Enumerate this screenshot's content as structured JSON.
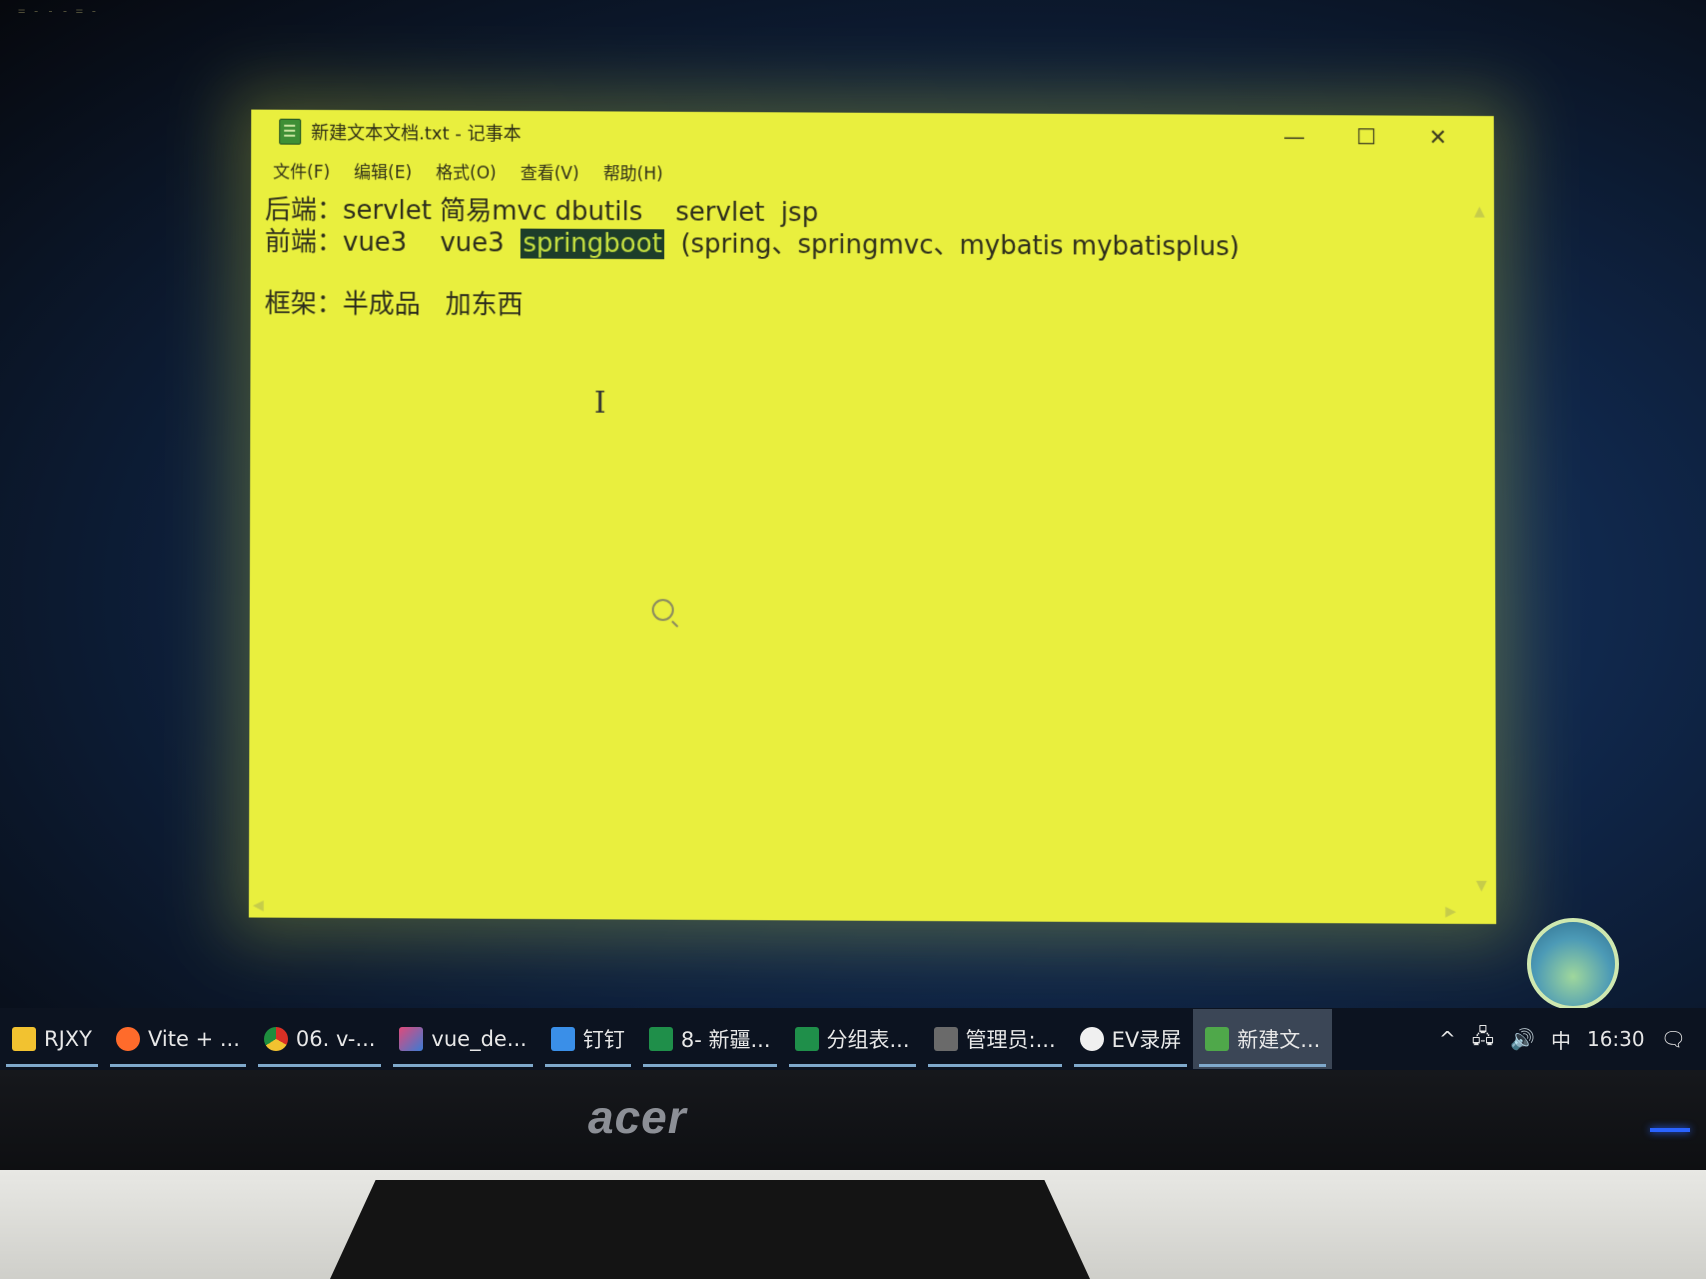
{
  "desktop": {
    "corner_text": "= - - -\n  = -"
  },
  "notepad": {
    "title": "新建文本文档.txt - 记事本",
    "buttons": {
      "minimize": "—",
      "maximize": "☐",
      "close": "✕"
    },
    "menu": [
      "文件(F)",
      "编辑(E)",
      "格式(O)",
      "查看(V)",
      "帮助(H)"
    ],
    "lines": {
      "l1": "后端：servlet 简易mvc dbutils    servlet  jsp",
      "l2a": "前端：vue3    vue3  ",
      "l2_sel": "springboot",
      "l2b": "  (spring、springmvc、mybatis mybatisplus)",
      "l3": "框架：半成品   加东西"
    }
  },
  "taskbar": {
    "items": [
      {
        "label": "RJXY",
        "icon": "folder-icon",
        "color": "#f2c230"
      },
      {
        "label": "Vite + ...",
        "icon": "firefox-icon",
        "color": "#ff6b2b"
      },
      {
        "label": "06. v-...",
        "icon": "chrome-icon",
        "color": "#e6b422"
      },
      {
        "label": "vue_de...",
        "icon": "intellij-icon",
        "color": "#e04a7a"
      },
      {
        "label": "钉钉",
        "icon": "dingtalk-icon",
        "color": "#3a8fe8"
      },
      {
        "label": "8- 新疆...",
        "icon": "excel-icon",
        "color": "#1f8f4a"
      },
      {
        "label": "分组表...",
        "icon": "excel-icon",
        "color": "#1f8f4a"
      },
      {
        "label": "管理员:...",
        "icon": "terminal-icon",
        "color": "#6a6a6a"
      },
      {
        "label": "EV录屏",
        "icon": "ev-recorder-icon",
        "color": "#f0f0f0"
      },
      {
        "label": "新建文...",
        "icon": "notepad-icon",
        "color": "#4fa84a"
      }
    ],
    "tray": {
      "chevron": "^",
      "ime": "中",
      "time": "16:30"
    }
  },
  "monitor": {
    "brand": "acer"
  }
}
